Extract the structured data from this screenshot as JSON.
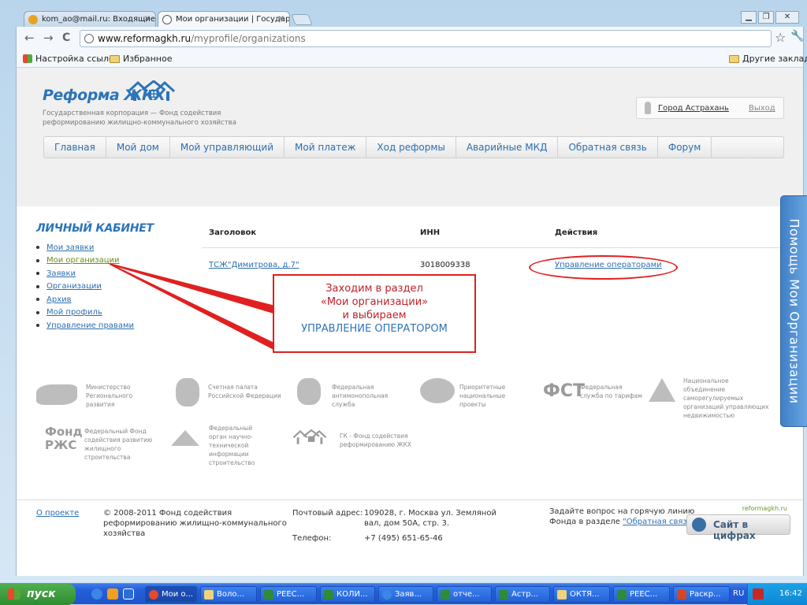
{
  "browser": {
    "tabs": [
      {
        "label": "kom_ao@mail.ru: Входящие"
      },
      {
        "label": "Мои организации | Государс"
      }
    ],
    "close_symbol": "×",
    "url_domain": "www.reformagkh.ru",
    "url_path": "/myprofile/organizations",
    "bookmarks": [
      {
        "label": "Настройка ссылок"
      },
      {
        "label": "Избранное"
      }
    ],
    "other_bookmarks": "Другие закладки",
    "nav_symbols": {
      "back": "←",
      "forward": "→",
      "reload": "C"
    },
    "star_symbol": "☆",
    "wrench_symbol": "🔧",
    "window_controls": [
      "▁",
      "❐",
      "✕"
    ]
  },
  "site": {
    "logo": "Реформа ЖКХ",
    "tagline": "Государственная корпорация — Фонд содействия реформированию жилищно-коммунального хозяйства",
    "city": "Город Астрахань",
    "logout": "Выход",
    "nav": [
      "Главная",
      "Мой дом",
      "Мой управляющий",
      "Мой платеж",
      "Ход реформы",
      "Аварийные МКД",
      "Обратная связь",
      "Форум"
    ]
  },
  "sidebar": {
    "title": "ЛИЧНЫЙ КАБИНЕТ",
    "items": [
      "Мои заявки",
      "Мои организации",
      "Заявки",
      "Организации",
      "Архив",
      "Мой профиль",
      "Управление правами"
    ],
    "active_index": 1
  },
  "table": {
    "headers": [
      "Заголовок",
      "ИНН",
      "Действия"
    ],
    "rows": [
      {
        "title": "ТСЖ\"Димитрова, д.7\"",
        "inn": "3018009338",
        "action": "Управление операторами"
      }
    ]
  },
  "callout": {
    "line1": "Заходим в раздел",
    "line2": "«Мои организации»",
    "line3": "и выбираем",
    "line4": "УПРАВЛЕНИЕ ОПЕРАТОРОМ"
  },
  "partners": [
    "Министерство Регионального развития",
    "Счетная палата Российской Федерации",
    "Федеральная антимонопольная служба",
    "Приоритетные национальные проекты",
    "Федеральная служба по тарифам",
    "Национальное объединение саморегулируемых организаций управляющих недвижимостью",
    "Федеральный Фонд содействия развитию жилищного строительства",
    "Федеральный орган научно-технической информации строительство",
    "ГК - Фонд содействия реформированию ЖКХ"
  ],
  "partner_logos": {
    "fst": "ФСТ",
    "fond_rzhs": "Фонд РЖС"
  },
  "footer": {
    "about": "О проекте",
    "copyright": "© 2008-2011 Фонд содействия реформированию жилищно-коммунального хозяйства",
    "postal_label": "Почтовый адрес:",
    "postal_value": "109028, г. Москва ул. Земляной вал, дом 50А, стр. 3.",
    "phone_label": "Телефон:",
    "phone_value": "+7 (495) 651-65-46",
    "question": "Задайте вопрос на горячую линию Фонда в разделе",
    "feedback_link": "\"Обратная связь\"",
    "cifry_url": "reformagkh.ru",
    "cifry_label": "Сайт в цифрах"
  },
  "help_tab": "Помощь Мои Организации",
  "taskbar": {
    "start": "пуск",
    "items": [
      "Мои о...",
      "Воло...",
      "РЕЕС...",
      "КОЛИ...",
      "Заяв...",
      "отче...",
      "Астр...",
      "ОКТЯ...",
      "РЕЕС...",
      "Раскр..."
    ],
    "lang": "RU",
    "time": "16:42"
  },
  "colors": {
    "accent": "#2d74b8",
    "annotation": "#e02020"
  }
}
